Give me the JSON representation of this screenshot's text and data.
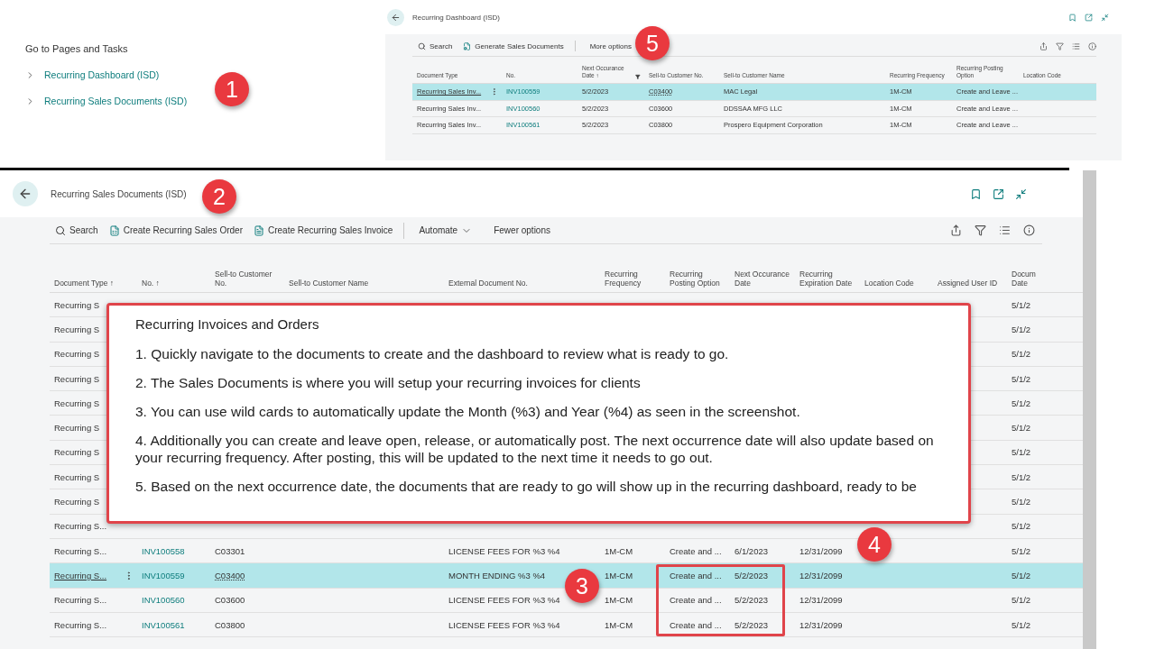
{
  "nav": {
    "title": "Go to Pages and Tasks",
    "links": [
      "Recurring Dashboard (ISD)",
      "Recurring Sales Documents (ISD)"
    ]
  },
  "dashboard": {
    "title": "Recurring Dashboard (ISD)",
    "toolbar": [
      {
        "kind": "search",
        "label": "Search"
      },
      {
        "kind": "generate",
        "label": "Generate Sales Documents"
      },
      {
        "kind": "option",
        "label": "More options"
      }
    ],
    "columns": [
      {
        "label": "Document Type",
        "kind": "text",
        "filtered": false
      },
      {
        "label": "No.",
        "kind": "link",
        "filtered": false
      },
      {
        "label": "Next Occurance Date ↑",
        "kind": "text",
        "filtered": true
      },
      {
        "label": "Sell-to Customer No.",
        "kind": "text",
        "filtered": false
      },
      {
        "label": "Sell-to Customer Name",
        "kind": "text",
        "filtered": false
      },
      {
        "label": "Recurring Frequency",
        "kind": "text",
        "filtered": false
      },
      {
        "label": "Recurring Posting Option",
        "kind": "text",
        "filtered": false
      },
      {
        "label": "Location Code",
        "kind": "text",
        "filtered": false
      }
    ],
    "rows": [
      {
        "selected": true,
        "cells": [
          "Recurring Sales Inv...",
          "INV100559",
          "5/2/2023",
          "C03400",
          "MAC Legal",
          "1M-CM",
          "Create and Leave ...",
          null
        ]
      },
      {
        "selected": false,
        "cells": [
          "Recurring Sales Inv...",
          "INV100560",
          "5/2/2023",
          "C03600",
          "DDSSAA MFG LLC",
          "1M-CM",
          "Create and Leave ...",
          null
        ]
      },
      {
        "selected": false,
        "cells": [
          "Recurring Sales Inv...",
          "INV100561",
          "5/2/2023",
          "C03800",
          "Prospero Equipment Corporation",
          "1M-CM",
          "Create and Leave ...",
          null
        ]
      }
    ]
  },
  "documents": {
    "title": "Recurring Sales Documents (ISD)",
    "toolbar": [
      {
        "kind": "search",
        "label": "Search"
      },
      {
        "kind": "order",
        "label": "Create Recurring Sales Order"
      },
      {
        "kind": "invoice",
        "label": "Create Recurring Sales Invoice"
      },
      {
        "kind": "menu",
        "label": "Automate"
      },
      {
        "kind": "option",
        "label": "Fewer options"
      }
    ],
    "columns": [
      {
        "label": "Document Type ↑",
        "kind": "text"
      },
      {
        "label": "No. ↑",
        "kind": "link"
      },
      {
        "label": "Sell-to Customer No.",
        "kind": "text"
      },
      {
        "label": "Sell-to Customer Name",
        "kind": "text"
      },
      {
        "label": "External Document No.",
        "kind": "text"
      },
      {
        "label": "Recurring Frequency",
        "kind": "text"
      },
      {
        "label": "Recurring Posting Option",
        "kind": "text"
      },
      {
        "label": "Next Occurance Date",
        "kind": "text"
      },
      {
        "label": "Recurring Expiration Date",
        "kind": "text"
      },
      {
        "label": "Location Code",
        "kind": "text"
      },
      {
        "label": "Assigned User ID",
        "kind": "text"
      },
      {
        "label": "Docum Date",
        "kind": "text"
      }
    ],
    "rows": [
      {
        "selected": false,
        "cells": [
          "Recurring S",
          null,
          null,
          null,
          null,
          null,
          null,
          null,
          null,
          null,
          null,
          "5/1/2"
        ]
      },
      {
        "selected": false,
        "cells": [
          "Recurring S",
          null,
          null,
          null,
          null,
          null,
          null,
          null,
          null,
          null,
          null,
          "5/1/2"
        ]
      },
      {
        "selected": false,
        "cells": [
          "Recurring S",
          null,
          null,
          null,
          null,
          null,
          null,
          null,
          null,
          null,
          null,
          "5/1/2"
        ]
      },
      {
        "selected": false,
        "cells": [
          "Recurring S",
          null,
          null,
          null,
          null,
          null,
          null,
          null,
          null,
          null,
          null,
          "5/1/2"
        ]
      },
      {
        "selected": false,
        "cells": [
          "Recurring S",
          null,
          null,
          null,
          null,
          null,
          null,
          null,
          null,
          null,
          null,
          "5/1/2"
        ]
      },
      {
        "selected": false,
        "cells": [
          "Recurring S",
          null,
          null,
          null,
          null,
          null,
          null,
          null,
          null,
          null,
          null,
          "5/1/2"
        ]
      },
      {
        "selected": false,
        "cells": [
          "Recurring S",
          null,
          null,
          null,
          null,
          null,
          null,
          null,
          null,
          null,
          null,
          "5/1/2"
        ]
      },
      {
        "selected": false,
        "cells": [
          "Recurring S",
          null,
          null,
          null,
          null,
          null,
          null,
          null,
          null,
          null,
          null,
          "5/1/2"
        ]
      },
      {
        "selected": false,
        "cells": [
          "Recurring S",
          null,
          null,
          null,
          null,
          null,
          null,
          null,
          null,
          null,
          null,
          "5/1/2"
        ]
      },
      {
        "selected": false,
        "cells": [
          "Recurring S...",
          null,
          null,
          null,
          null,
          null,
          null,
          null,
          null,
          null,
          null,
          "5/1/2"
        ]
      },
      {
        "selected": false,
        "cells": [
          "Recurring S...",
          "INV100558",
          "C03301",
          null,
          "LICENSE FEES FOR %3 %4",
          "1M-CM",
          "Create and ...",
          "6/1/2023",
          "12/31/2099",
          null,
          null,
          "5/1/2"
        ]
      },
      {
        "selected": true,
        "cells": [
          "Recurring S...",
          "INV100559",
          "C03400",
          null,
          "MONTH ENDING %3 %4",
          "1M-CM",
          "Create and ...",
          "5/2/2023",
          "12/31/2099",
          null,
          null,
          "5/1/2"
        ]
      },
      {
        "selected": false,
        "cells": [
          "Recurring S...",
          "INV100560",
          "C03600",
          null,
          "LICENSE FEES FOR %3 %4",
          "1M-CM",
          "Create and ...",
          "5/2/2023",
          "12/31/2099",
          null,
          null,
          "5/1/2"
        ]
      },
      {
        "selected": false,
        "cells": [
          "Recurring S...",
          "INV100561",
          "C03800",
          null,
          "LICENSE FEES FOR %3 %4",
          "1M-CM",
          "Create and ...",
          "5/2/2023",
          "12/31/2099",
          null,
          null,
          "5/1/2"
        ]
      }
    ]
  },
  "callout": {
    "title": "Recurring Invoices and Orders",
    "paragraphs": [
      "1. Quickly navigate to the documents to create and the dashboard to review what is ready to go.",
      "2. The Sales Documents is where you will setup your recurring invoices for clients",
      "3. You can use wild cards to automatically update the Month (%3) and Year (%4) as seen in the screenshot.",
      "4. Additionally you can create and leave open, release, or automatically post. The next occurrence date will also update based on your recurring frequency. After posting, this will be updated to the next time it needs to go out.",
      "5. Based on the next occurrence date, the documents that are ready to go will show up in the recurring dashboard, ready to be"
    ]
  },
  "badges": [
    "1",
    "2",
    "3",
    "4",
    "5"
  ]
}
